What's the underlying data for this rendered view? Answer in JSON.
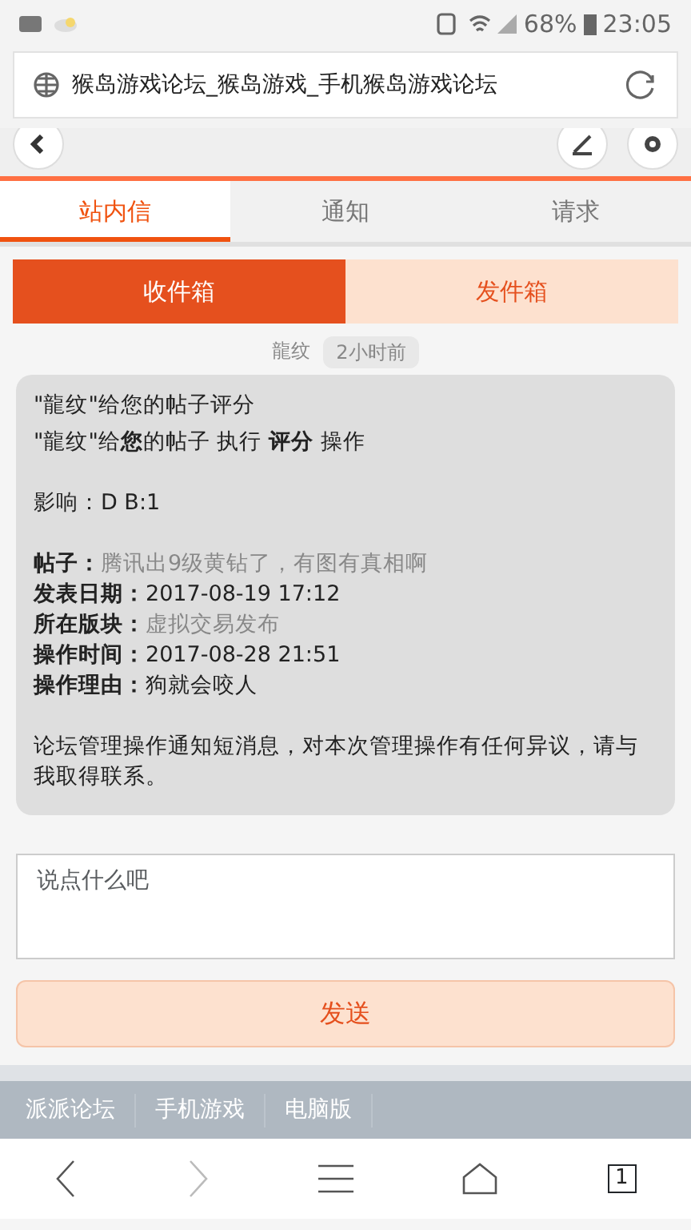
{
  "status_bar": {
    "battery": "68%",
    "time": "23:05"
  },
  "browser": {
    "url_title": "猴岛游戏论坛_猴岛游戏_手机猴岛游戏论坛"
  },
  "tabs": [
    {
      "label": "站内信",
      "selected": true
    },
    {
      "label": "通知",
      "selected": false
    },
    {
      "label": "请求",
      "selected": false
    }
  ],
  "boxes": [
    {
      "label": "收件箱",
      "selected": true
    },
    {
      "label": "发件箱",
      "selected": false
    }
  ],
  "message": {
    "sender": "龍纹",
    "time": "2小时前",
    "lines": [
      "\"龍纹\"给您的帖子评分",
      "\"龍纹\"给**您**的帖子 执行 **评分** 操作"
    ],
    "impact": "影响：D B:1",
    "fields": [
      {
        "label": "帖子：",
        "value": "腾讯出9级黄钻了，有图有真相啊",
        "kind": "link"
      },
      {
        "label": "发表日期：",
        "value": "2017-08-19 17:12",
        "kind": "text"
      },
      {
        "label": "所在版块：",
        "value": "虚拟交易发布",
        "kind": "link"
      },
      {
        "label": "操作时间：",
        "value": "2017-08-28 21:51",
        "kind": "text"
      },
      {
        "label": "操作理由：",
        "value": "狗就会咬人",
        "kind": "text"
      }
    ],
    "note": "论坛管理操作通知短消息，对本次管理操作有任何异议，请与我取得联系。"
  },
  "reply": {
    "placeholder": "说点什么吧",
    "button": "发送"
  },
  "footer_links": [
    "派派论坛",
    "手机游戏",
    "电脑版"
  ],
  "browser_nav": {
    "tabs_count": "1"
  }
}
